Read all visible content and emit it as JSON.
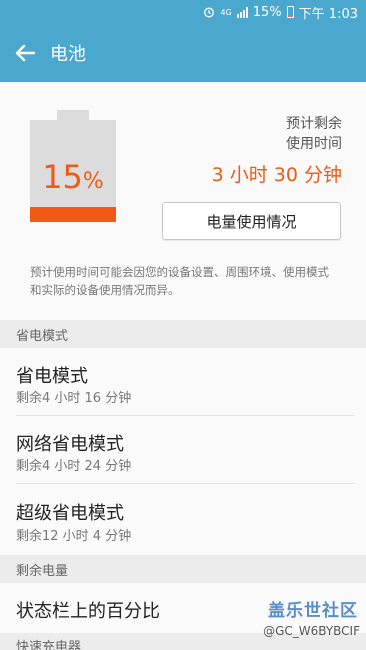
{
  "status_bar": {
    "time": "下午 1:03",
    "battery_percent": "15%",
    "network": "4G",
    "alarm_icon": "alarm-clock-icon",
    "signal_icon": "signal-icon",
    "battery_icon": "battery-icon"
  },
  "app_bar": {
    "title": "电池",
    "back_icon": "back-arrow-icon"
  },
  "battery": {
    "level_percent": 15,
    "percent_number": "15",
    "percent_sign": "%",
    "estimate_label_line1": "预计剩余",
    "estimate_label_line2": "使用时间",
    "estimate_time": "3 小时 30 分钟",
    "usage_button_label": "电量使用情况",
    "note": "预计使用时间可能会因您的设备设置、周围环境、使用模式和实际的设备使用情况而异。",
    "fill_color": "#f05a14"
  },
  "sections": {
    "power_saving_header": "省电模式",
    "remaining_header": "剩余电量",
    "fast_charge_header": "快速充电器"
  },
  "power_saving_items": [
    {
      "title": "省电模式",
      "subtitle": "剩余4 小时 16 分钟"
    },
    {
      "title": "网络省电模式",
      "subtitle": "剩余4 小时 24 分钟"
    },
    {
      "title": "超级省电模式",
      "subtitle": "剩余12 小时 4 分钟"
    }
  ],
  "remaining_items": [
    {
      "title": "状态栏上的百分比"
    }
  ],
  "watermark": {
    "logo_text": "盖乐世社区",
    "user_id": "@GC_W6BYBCIF"
  },
  "colors": {
    "accent": "#4aa7cd",
    "battery_orange": "#f05a14"
  }
}
